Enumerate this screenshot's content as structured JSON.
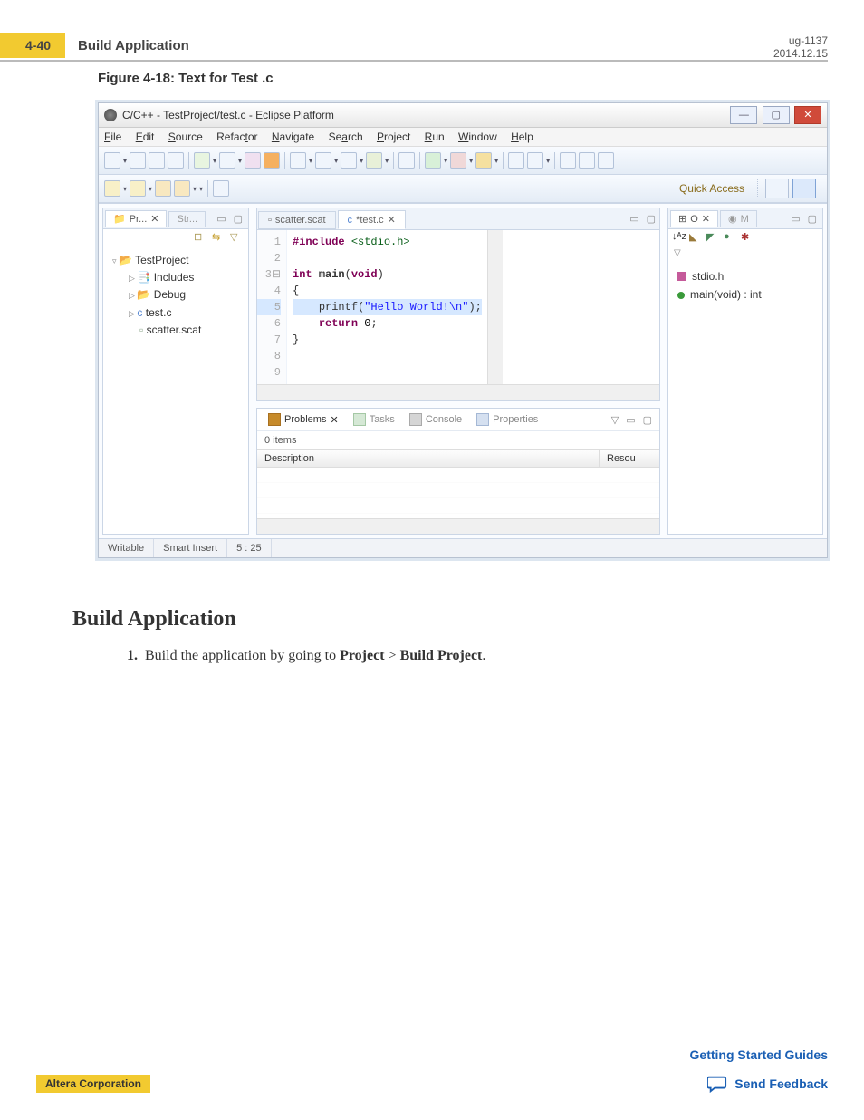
{
  "header": {
    "pageTab": "4-40",
    "title": "Build Application",
    "docId": "ug-1137",
    "date": "2014.12.15"
  },
  "figure": {
    "caption": "Figure 4-18: Text for Test .c"
  },
  "window": {
    "title": "C/C++ - TestProject/test.c - Eclipse Platform",
    "menus": [
      "File",
      "Edit",
      "Source",
      "Refactor",
      "Navigate",
      "Search",
      "Project",
      "Run",
      "Window",
      "Help"
    ],
    "quickAccess": "Quick Access"
  },
  "projectExplorer": {
    "tabActive": "Pr...",
    "tabInactive": "Str...",
    "root": "TestProject",
    "items": [
      "Includes",
      "Debug",
      "test.c",
      "scatter.scat"
    ]
  },
  "editor": {
    "tabs": [
      "scatter.scat",
      "*test.c"
    ],
    "lines": [
      "1",
      "2",
      "3",
      "4",
      "5",
      "6",
      "7",
      "8",
      "9"
    ],
    "l1_pp": "#include ",
    "l1_inc": "<stdio.h>",
    "l3_a": "int ",
    "l3_b": "main",
    "l3_c": "(",
    "l3_d": "void",
    "l3_e": ")",
    "l4": "{",
    "l5_a": "printf(",
    "l5_b": "\"Hello World!",
    "l5_c": "\\n",
    "l5_d": "\"",
    "l5_e": ");",
    "l6_a": "return ",
    "l6_b": "0",
    "l6_c": ";",
    "l7": "}"
  },
  "outline": {
    "tabA": "O",
    "tabB": "M",
    "items": [
      {
        "label": "stdio.h"
      },
      {
        "label": "main(void) : int"
      }
    ]
  },
  "problems": {
    "tabs": [
      "Problems",
      "Tasks",
      "Console",
      "Properties"
    ],
    "count": "0 items",
    "cols": [
      "Description",
      "Resou"
    ]
  },
  "status": {
    "a": "Writable",
    "b": "Smart Insert",
    "c": "5 : 25"
  },
  "section": {
    "heading": "Build Application",
    "stepNum": "1.",
    "stepPre": "Build the application by going to ",
    "stepB1": "Project",
    "stepMid": " > ",
    "stepB2": "Build Project",
    "stepEnd": "."
  },
  "footer": {
    "left": "Altera Corporation",
    "link": "Getting Started Guides",
    "feedback": "Send Feedback"
  }
}
